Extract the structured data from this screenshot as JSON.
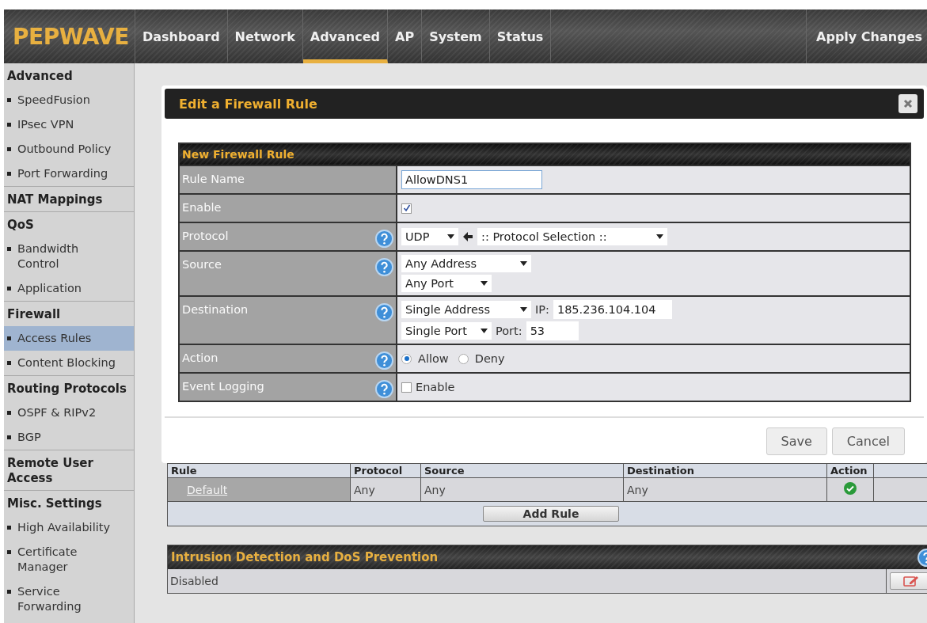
{
  "brand": "PEPWAVE",
  "nav": {
    "tabs": [
      {
        "label": "Dashboard",
        "selected": false
      },
      {
        "label": "Network",
        "selected": false
      },
      {
        "label": "Advanced",
        "selected": true
      },
      {
        "label": "AP",
        "selected": false
      },
      {
        "label": "System",
        "selected": false
      },
      {
        "label": "Status",
        "selected": false
      }
    ],
    "apply": "Apply Changes"
  },
  "sidebar": {
    "sections": [
      {
        "title": "Advanced",
        "items": [
          {
            "label": "SpeedFusion",
            "selected": false
          },
          {
            "label": "IPsec VPN",
            "selected": false
          },
          {
            "label": "Outbound Policy",
            "selected": false
          },
          {
            "label": "Port Forwarding",
            "selected": false
          }
        ]
      },
      {
        "title": "NAT Mappings"
      },
      {
        "title": "QoS",
        "items": [
          {
            "label": "Bandwidth Control",
            "selected": false
          },
          {
            "label": "Application",
            "selected": false
          }
        ]
      },
      {
        "title": "Firewall",
        "items": [
          {
            "label": "Access Rules",
            "selected": true
          },
          {
            "label": "Content Blocking",
            "selected": false
          }
        ]
      },
      {
        "title": "Routing Protocols",
        "items": [
          {
            "label": "OSPF & RIPv2",
            "selected": false
          },
          {
            "label": "BGP",
            "selected": false
          }
        ]
      },
      {
        "title": "Remote User Access"
      },
      {
        "title": "Misc. Settings",
        "items": [
          {
            "label": "High Availability",
            "selected": false
          },
          {
            "label": "Certificate Manager",
            "selected": false
          },
          {
            "label": "Service Forwarding",
            "selected": false
          }
        ]
      }
    ]
  },
  "dialog": {
    "title": "Edit a Firewall Rule",
    "section_title": "New Firewall Rule",
    "rows": [
      {
        "label": "Rule Name",
        "help": false,
        "kind": "text",
        "value": "AllowDNS1"
      },
      {
        "label": "Enable",
        "help": false,
        "kind": "checkbox",
        "checked": true
      },
      {
        "label": "Protocol",
        "help": true,
        "kind": "protocol",
        "select": "UDP",
        "preset": ":: Protocol Selection ::"
      },
      {
        "label": "Source",
        "help": true,
        "kind": "lines",
        "lines": [
          {
            "select": "Any Address"
          },
          {
            "select": "Any Port"
          }
        ]
      },
      {
        "label": "Destination",
        "help": true,
        "kind": "lines",
        "lines": [
          {
            "select": "Single Address",
            "field_label": "IP:",
            "field_value": "185.236.104.104"
          },
          {
            "select": "Single Port",
            "field_label": "Port:",
            "field_value": "53"
          }
        ]
      },
      {
        "label": "Action",
        "help": true,
        "kind": "radio",
        "options": [
          {
            "label": "Allow",
            "selected": true
          },
          {
            "label": "Deny",
            "selected": false
          }
        ]
      },
      {
        "label": "Event Logging",
        "help": true,
        "kind": "checkbox",
        "checked": false,
        "text": "Enable"
      }
    ],
    "buttons": [
      "Save",
      "Cancel"
    ]
  },
  "rules_table": {
    "columns": [
      "Rule",
      "Protocol",
      "Source",
      "Destination",
      "Action"
    ],
    "rows": [
      {
        "cells": [
          "Default",
          "Any",
          "Any",
          "Any"
        ],
        "allowed": true
      }
    ],
    "add_button": "Add Rule"
  },
  "intrusion": {
    "title": "Intrusion Detection and DoS Prevention",
    "status": "Disabled"
  }
}
